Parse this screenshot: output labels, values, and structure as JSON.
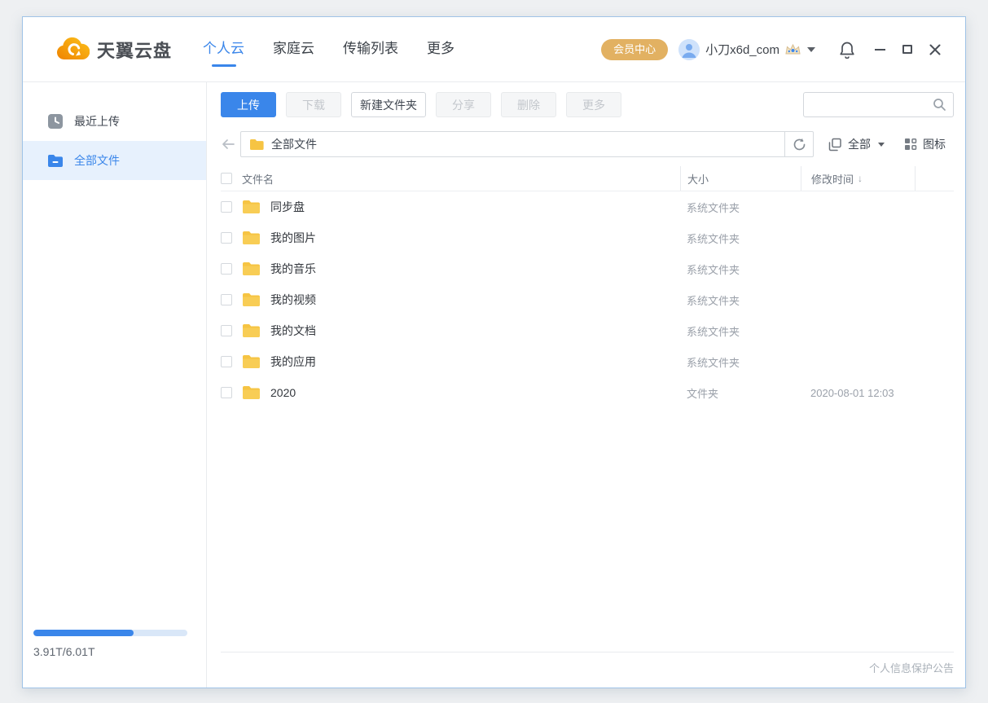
{
  "window": {
    "brand": "天翼云盘",
    "nav": [
      {
        "label": "个人云",
        "active": true
      },
      {
        "label": "家庭云",
        "active": false
      },
      {
        "label": "传输列表",
        "active": false
      },
      {
        "label": "更多",
        "active": false
      }
    ],
    "member_button": "会员中心",
    "username": "小刀x6d_com"
  },
  "toolbar": {
    "buttons": [
      {
        "label": "上传",
        "state": "primary"
      },
      {
        "label": "下载",
        "state": "disabled"
      },
      {
        "label": "新建文件夹",
        "state": "normal"
      },
      {
        "label": "分享",
        "state": "disabled"
      },
      {
        "label": "删除",
        "state": "disabled"
      },
      {
        "label": "更多",
        "state": "disabled"
      }
    ],
    "search": {
      "value": "",
      "placeholder": ""
    }
  },
  "addressbar": {
    "path": "全部文件",
    "filter_label": "全部",
    "view_label": "图标"
  },
  "table": {
    "columns": {
      "name": "文件名",
      "size": "大小",
      "time": "修改时间"
    },
    "sort_indicator": "↓",
    "rows": [
      {
        "name": "同步盘",
        "size": "系统文件夹",
        "time": ""
      },
      {
        "name": "我的图片",
        "size": "系统文件夹",
        "time": ""
      },
      {
        "name": "我的音乐",
        "size": "系统文件夹",
        "time": ""
      },
      {
        "name": "我的视频",
        "size": "系统文件夹",
        "time": ""
      },
      {
        "name": "我的文档",
        "size": "系统文件夹",
        "time": ""
      },
      {
        "name": "我的应用",
        "size": "系统文件夹",
        "time": ""
      },
      {
        "name": "2020",
        "size": "文件夹",
        "time": "2020-08-01 12:03"
      }
    ]
  },
  "sidebar": {
    "items": [
      {
        "label": "最近上传",
        "icon": "clock-icon",
        "active": false
      },
      {
        "label": "全部文件",
        "icon": "folder-icon",
        "active": true
      }
    ],
    "storage": {
      "text": "3.91T/6.01T",
      "percent": 65
    }
  },
  "footer": {
    "notice": "个人信息保护公告"
  },
  "icons": [
    "cloud-logo-icon",
    "avatar-icon",
    "vip-crown-icon",
    "caret-down-icon",
    "bell-icon",
    "minimize-icon",
    "maximize-icon",
    "close-icon",
    "search-icon",
    "back-arrow-icon",
    "folder-yellow-icon",
    "refresh-icon",
    "filter-copy-icon",
    "grid-view-icon",
    "clock-icon",
    "folder-blue-icon",
    "checkbox",
    "sort-desc-icon"
  ],
  "colors": {
    "primary_blue": "#3a86ea",
    "folder_yellow": "#f6c443",
    "member_gold": "#e2b162",
    "sidebar_active_bg": "#e7f1fd",
    "window_border": "#9fc3e7"
  }
}
